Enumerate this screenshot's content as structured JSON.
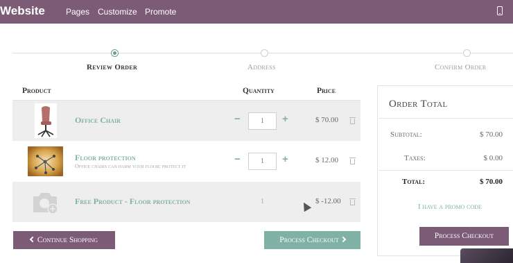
{
  "topbar": {
    "brand": "Website",
    "menu": [
      "Pages",
      "Customize",
      "Promote"
    ],
    "device_icon": "mobile-phone-icon",
    "color": "#7c5b76"
  },
  "wizard": {
    "steps": [
      {
        "label": "Review Order",
        "active": true
      },
      {
        "label": "Address",
        "active": false
      },
      {
        "label": "Confirm Order",
        "active": false
      }
    ]
  },
  "cart": {
    "headers": {
      "product": "Product",
      "quantity": "Quantity",
      "price": "Price"
    },
    "items": [
      {
        "name": "Office Chair",
        "description": "",
        "quantity": "1",
        "price": "$ 70.00",
        "thumb_icon": "office-chair-thumbnail"
      },
      {
        "name": "Floor protection",
        "description": "Office chairs can harm your floor: protect it",
        "quantity": "1",
        "price": "$ 12.00",
        "thumb_icon": "floor-protection-thumbnail"
      },
      {
        "name": "Free Product - Floor protection",
        "description": "",
        "quantity": "1",
        "price": "$ -12.00",
        "thumb_icon": "camera-placeholder-icon"
      }
    ],
    "accent": "#7fb1a5"
  },
  "order_total": {
    "title": "Order Total",
    "subtotal_label": "Subtotal:",
    "subtotal_value": "$ 70.00",
    "taxes_label": "Taxes:",
    "taxes_value": "$ 0.00",
    "total_label": "Total:",
    "total_value": "$ 70.00",
    "promo": "I have a promo code",
    "checkout": "Process Checkout"
  },
  "actions": {
    "continue": "Continue Shopping",
    "checkout": "Process Checkout"
  }
}
